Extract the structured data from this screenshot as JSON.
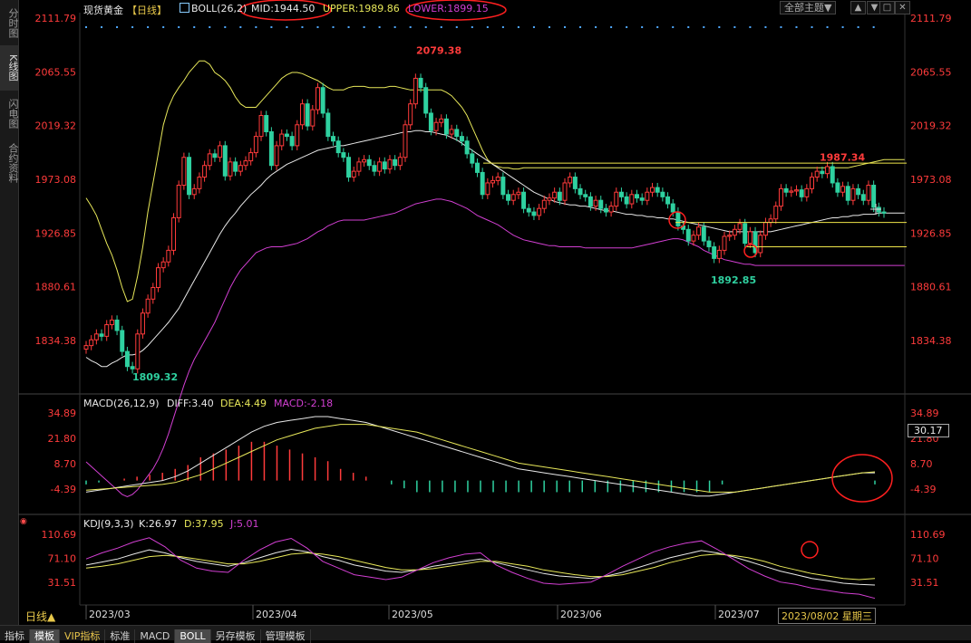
{
  "header": {
    "symbol": "现货黄金",
    "period_tag": "【日线】",
    "boll_label": "BOLL(26,2)",
    "mid": "MID:1944.50",
    "upper": "UPPER:1989.86",
    "lower": "LOWER:1899.15"
  },
  "toolbar": {
    "theme_label": "全部主题▼",
    "up_btn": "▲",
    "down_btn": "▼",
    "box_btn": "□",
    "close_btn": "✕"
  },
  "sidebar": {
    "items": [
      "分时图",
      "K线图",
      "闪电图",
      "合约资料"
    ]
  },
  "macd_header": {
    "name": "MACD(26,12,9)",
    "diff": "DIFF:3.40",
    "dea": "DEA:4.49",
    "macd": "MACD:-2.18"
  },
  "kdj_header": {
    "name": "KDJ(9,3,3)",
    "k": "K:26.97",
    "d": "D:37.95",
    "j": "J:5.01"
  },
  "period_button": "日线▲",
  "date_readout": "2023/08/02 星期三",
  "macd_current_value": "30.17",
  "bottom_tabs": [
    "指标",
    "模板",
    "VIP指标",
    "标准",
    "MACD",
    "BOLL",
    "另存模板",
    "管理模板"
  ],
  "colors": {
    "up": "#ff3b3b",
    "down": "#2fd1a0",
    "upper": "#e8e85a",
    "mid": "#e8e8e8",
    "lower": "#d23fd2",
    "axis": "#ff3b3b"
  },
  "chart_data": [
    {
      "type": "candlestick",
      "title": "现货黄金 日线",
      "y_ticks": [
        2111.79,
        2065.55,
        2019.32,
        1973.08,
        1926.85,
        1880.61,
        1834.38
      ],
      "x_ticks": [
        "2023/03",
        "2023/04",
        "2023/05",
        "2023/06",
        "2023/07"
      ],
      "annotations": [
        {
          "label": "2079.38",
          "value": 2079.38,
          "kind": "high"
        },
        {
          "label": "1987.34",
          "value": 1987.34,
          "kind": "high"
        },
        {
          "label": "1892.85",
          "value": 1892.85,
          "kind": "low"
        },
        {
          "label": "1809.32",
          "value": 1809.32,
          "kind": "low"
        }
      ],
      "close": [
        1830,
        1835,
        1840,
        1838,
        1848,
        1852,
        1843,
        1825,
        1812,
        1810,
        1840,
        1858,
        1870,
        1880,
        1897,
        1902,
        1912,
        1940,
        1968,
        1992,
        1960,
        1965,
        1975,
        1985,
        1995,
        1992,
        2002,
        1976,
        1988,
        1980,
        1985,
        1989,
        1996,
        2010,
        2028,
        2014,
        1985,
        2002,
        2012,
        2010,
        2002,
        2020,
        2038,
        2019,
        2033,
        2052,
        2030,
        2010,
        2006,
        1996,
        1992,
        1975,
        1980,
        1988,
        1990,
        1985,
        1980,
        1988,
        1982,
        1990,
        1985,
        1992,
        2020,
        2038,
        2060,
        2052,
        2030,
        2015,
        2022,
        2025,
        2012,
        2016,
        2010,
        2006,
        1995,
        1987,
        1979,
        1960,
        1970,
        1972,
        1975,
        1960,
        1955,
        1960,
        1962,
        1948,
        1945,
        1942,
        1948,
        1955,
        1957,
        1962,
        1955,
        1970,
        1975,
        1965,
        1960,
        1958,
        1950,
        1955,
        1948,
        1945,
        1950,
        1962,
        1958,
        1952,
        1960,
        1957,
        1955,
        1962,
        1966,
        1962,
        1958,
        1952,
        1945,
        1933,
        1930,
        1920,
        1925,
        1932,
        1920,
        1915,
        1905,
        1912,
        1924,
        1925,
        1930,
        1935,
        1918,
        1928,
        1910,
        1925,
        1936,
        1939,
        1950,
        1965,
        1962,
        1963,
        1964,
        1958,
        1965,
        1975,
        1980,
        1978,
        1984,
        1970,
        1962,
        1967,
        1955,
        1965,
        1960,
        1955,
        1968,
        1949,
        1945,
        1944
      ],
      "upper": [
        1957,
        1950,
        1942,
        1930,
        1918,
        1908,
        1895,
        1880,
        1868,
        1870,
        1890,
        1915,
        1945,
        1970,
        1995,
        2020,
        2035,
        2045,
        2052,
        2058,
        2065,
        2070,
        2075,
        2075,
        2072,
        2065,
        2062,
        2058,
        2052,
        2044,
        2038,
        2035,
        2035,
        2035,
        2040,
        2045,
        2050,
        2055,
        2060,
        2063,
        2065,
        2065,
        2064,
        2062,
        2060,
        2058,
        2055,
        2052,
        2050,
        2050,
        2050,
        2052,
        2053,
        2053,
        2053,
        2052,
        2052,
        2052,
        2052,
        2053,
        2053,
        2052,
        2051,
        2050,
        2050,
        2050,
        2050,
        2050,
        2050,
        2050,
        2048,
        2045,
        2040,
        2035,
        2028,
        2018,
        2008,
        1998,
        1990,
        1986,
        1984,
        1983,
        1983,
        1982,
        1982,
        1983,
        1983,
        1983,
        1983,
        1983,
        1983,
        1983,
        1983,
        1983,
        1983,
        1983,
        1983,
        1983,
        1983,
        1983,
        1983,
        1983,
        1983,
        1983,
        1983,
        1983,
        1983,
        1983,
        1983,
        1983,
        1983,
        1983,
        1983,
        1983,
        1983,
        1983,
        1983,
        1983,
        1983,
        1983,
        1983,
        1983,
        1983,
        1983,
        1983,
        1983,
        1983,
        1983,
        1983,
        1983,
        1983,
        1983,
        1983,
        1983,
        1983,
        1983,
        1983,
        1983,
        1983,
        1983,
        1983,
        1983,
        1983,
        1983,
        1983,
        1983,
        1983,
        1983,
        1983,
        1984,
        1985,
        1986,
        1987,
        1988,
        1989,
        1990,
        1990,
        1990,
        1990,
        1990
      ],
      "mid": [
        1820,
        1817,
        1815,
        1812,
        1812,
        1815,
        1817,
        1820,
        1822,
        1822,
        1823,
        1826,
        1830,
        1835,
        1840,
        1845,
        1850,
        1856,
        1862,
        1870,
        1878,
        1886,
        1894,
        1902,
        1910,
        1918,
        1926,
        1933,
        1939,
        1944,
        1950,
        1955,
        1960,
        1964,
        1968,
        1973,
        1977,
        1980,
        1983,
        1986,
        1988,
        1990,
        1992,
        1994,
        1996,
        1998,
        1999,
        2000,
        2001,
        2002,
        2002,
        2003,
        2004,
        2005,
        2006,
        2007,
        2008,
        2009,
        2010,
        2011,
        2012,
        2013,
        2014,
        2014,
        2015,
        2015,
        2014,
        2014,
        2013,
        2012,
        2011,
        2009,
        2007,
        2004,
        2001,
        1998,
        1995,
        1992,
        1989,
        1986,
        1983,
        1980,
        1977,
        1974,
        1971,
        1968,
        1965,
        1962,
        1960,
        1958,
        1956,
        1954,
        1953,
        1952,
        1951,
        1951,
        1950,
        1950,
        1949,
        1948,
        1947,
        1946,
        1946,
        1945,
        1944,
        1943,
        1943,
        1942,
        1942,
        1941,
        1941,
        1940,
        1940,
        1939,
        1939,
        1938,
        1937,
        1936,
        1935,
        1934,
        1933,
        1932,
        1931,
        1930,
        1929,
        1928,
        1928,
        1928,
        1928,
        1928,
        1928,
        1928,
        1928,
        1928,
        1929,
        1930,
        1931,
        1932,
        1933,
        1934,
        1935,
        1936,
        1937,
        1938,
        1939,
        1940,
        1940,
        1941,
        1941,
        1942,
        1942,
        1943,
        1943,
        1943,
        1944,
        1944,
        1944,
        1944,
        1944,
        1944
      ],
      "lower": [
        1730,
        1726,
        1722,
        1718,
        1714,
        1710,
        1706,
        1702,
        1700,
        1702,
        1706,
        1712,
        1718,
        1724,
        1732,
        1742,
        1754,
        1768,
        1782,
        1796,
        1808,
        1818,
        1826,
        1834,
        1842,
        1850,
        1860,
        1870,
        1880,
        1888,
        1895,
        1900,
        1905,
        1910,
        1912,
        1914,
        1915,
        1915,
        1915,
        1916,
        1917,
        1918,
        1920,
        1922,
        1925,
        1928,
        1930,
        1933,
        1935,
        1937,
        1938,
        1938,
        1938,
        1938,
        1938,
        1939,
        1940,
        1941,
        1942,
        1943,
        1944,
        1946,
        1948,
        1950,
        1952,
        1953,
        1954,
        1955,
        1956,
        1956,
        1955,
        1954,
        1952,
        1950,
        1948,
        1945,
        1942,
        1940,
        1938,
        1936,
        1934,
        1931,
        1928,
        1925,
        1923,
        1921,
        1920,
        1919,
        1918,
        1917,
        1916,
        1916,
        1915,
        1915,
        1915,
        1915,
        1915,
        1914,
        1914,
        1914,
        1914,
        1914,
        1914,
        1914,
        1914,
        1914,
        1914,
        1915,
        1916,
        1917,
        1918,
        1919,
        1920,
        1921,
        1922,
        1922,
        1921,
        1919,
        1917,
        1915,
        1912,
        1910,
        1908,
        1906,
        1904,
        1903,
        1902,
        1901,
        1900,
        1900,
        1899,
        1899,
        1899,
        1899,
        1899,
        1899,
        1899,
        1899,
        1899,
        1899,
        1899,
        1899,
        1899,
        1899,
        1899,
        1899,
        1899,
        1899,
        1899,
        1899,
        1899,
        1899,
        1899,
        1899,
        1899,
        1899,
        1899,
        1899,
        1899,
        1899
      ]
    },
    {
      "type": "line",
      "title": "MACD(26,12,9)",
      "y_ticks": [
        34.89,
        21.8,
        8.7,
        -4.39
      ],
      "series": [
        {
          "name": "DIFF",
          "values": [
            -6,
            -5,
            -4,
            -3,
            -2,
            -1,
            0,
            2,
            5,
            9,
            13,
            17,
            21,
            25,
            28,
            30,
            31,
            32,
            33,
            33,
            32,
            31,
            30,
            28,
            26,
            24,
            22,
            20,
            18,
            16,
            14,
            12,
            10,
            8,
            6,
            5,
            4,
            3,
            2,
            1,
            0,
            -1,
            -2,
            -3,
            -4,
            -5,
            -6,
            -7,
            -8,
            -8,
            -7,
            -6,
            -5,
            -4,
            -3,
            -2,
            -1,
            0,
            1,
            2,
            3,
            4,
            4
          ]
        },
        {
          "name": "DEA",
          "values": [
            -5,
            -4.5,
            -4,
            -3.5,
            -3,
            -2.5,
            -2,
            -1,
            1,
            3,
            6,
            9,
            12,
            15,
            18,
            21,
            23,
            25,
            27,
            28,
            29,
            29,
            29,
            28,
            27,
            26,
            25,
            23,
            21,
            19,
            17,
            15,
            13,
            11,
            9,
            8,
            7,
            6,
            5,
            4,
            3,
            2,
            1,
            0,
            -1,
            -2,
            -3,
            -4,
            -5,
            -6,
            -6,
            -6,
            -5,
            -4,
            -3,
            -2,
            -1,
            0,
            1,
            2,
            3,
            4,
            4.5
          ]
        },
        {
          "name": "MACD",
          "values": [
            -2,
            -1,
            0,
            1,
            2,
            3,
            4,
            6,
            8,
            12,
            14,
            16,
            18,
            20,
            20,
            18,
            16,
            14,
            12,
            10,
            6,
            4,
            2,
            0,
            -2,
            -4,
            -6,
            -6,
            -6,
            -6,
            -6,
            -6,
            -6,
            -6,
            -6,
            -6,
            -6,
            -6,
            -6,
            -6,
            -6,
            -6,
            -6,
            -6,
            -6,
            -6,
            -6,
            -6,
            -6,
            -6,
            -2,
            0,
            0,
            0,
            0,
            0,
            0,
            0,
            0,
            0,
            0,
            0,
            -2
          ]
        }
      ]
    },
    {
      "type": "line",
      "title": "KDJ(9,3,3)",
      "y_ticks": [
        110.69,
        71.1,
        31.51
      ],
      "series": [
        {
          "name": "K",
          "values": [
            60,
            65,
            70,
            78,
            85,
            80,
            72,
            66,
            62,
            58,
            64,
            72,
            80,
            86,
            82,
            74,
            68,
            60,
            55,
            50,
            48,
            52,
            58,
            62,
            66,
            70,
            64,
            58,
            52,
            46,
            42,
            40,
            38,
            42,
            48,
            56,
            64,
            72,
            78,
            84,
            80,
            74,
            66,
            58,
            50,
            44,
            38,
            34,
            30,
            28,
            27
          ]
        },
        {
          "name": "D",
          "values": [
            55,
            58,
            62,
            68,
            74,
            76,
            74,
            70,
            66,
            62,
            62,
            66,
            72,
            78,
            80,
            78,
            74,
            68,
            62,
            56,
            52,
            52,
            54,
            58,
            62,
            66,
            66,
            62,
            58,
            52,
            48,
            44,
            41,
            41,
            44,
            50,
            56,
            64,
            70,
            76,
            78,
            76,
            72,
            66,
            58,
            52,
            46,
            42,
            38,
            36,
            38
          ]
        },
        {
          "name": "J",
          "values": [
            70,
            80,
            88,
            98,
            105,
            90,
            68,
            55,
            50,
            48,
            68,
            85,
            98,
            104,
            88,
            66,
            55,
            44,
            40,
            36,
            40,
            52,
            64,
            72,
            78,
            80,
            60,
            48,
            38,
            30,
            28,
            30,
            32,
            44,
            58,
            70,
            82,
            90,
            96,
            100,
            86,
            70,
            54,
            42,
            32,
            28,
            22,
            18,
            14,
            12,
            5
          ]
        }
      ]
    }
  ]
}
